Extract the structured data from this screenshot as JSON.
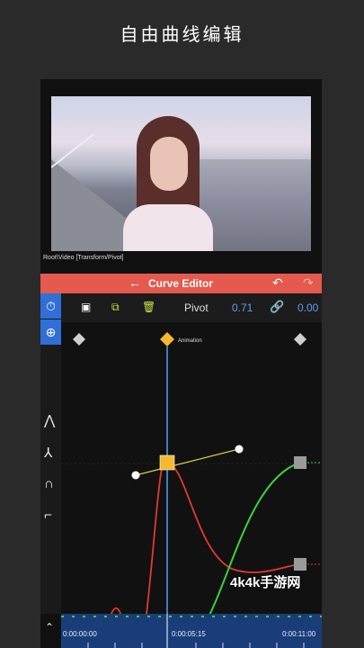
{
  "page_title": "自由曲线编辑",
  "path_label": "Root\\Video [Transform/Pivot]",
  "header": {
    "title": "Curve Editor",
    "back_icon": "←",
    "undo_icon": "↶",
    "redo_icon": "↷"
  },
  "toolbar": {
    "property": "Pivot",
    "value_x": "0.71",
    "value_y": "0.00"
  },
  "keyframe_label": "Animation",
  "timeline": {
    "start": "0:00:00:00",
    "mid": "0:00:05:15",
    "end": "0:00:11:00"
  },
  "watermark": "4k4k手游网",
  "colors": {
    "accent_red": "#e45a4e",
    "accent_blue": "#2f6fd6",
    "curve_red": "#e03a30",
    "curve_green": "#3ad13a",
    "handle_yellow": "#d9d43a",
    "key_orange": "#f5b82e"
  }
}
